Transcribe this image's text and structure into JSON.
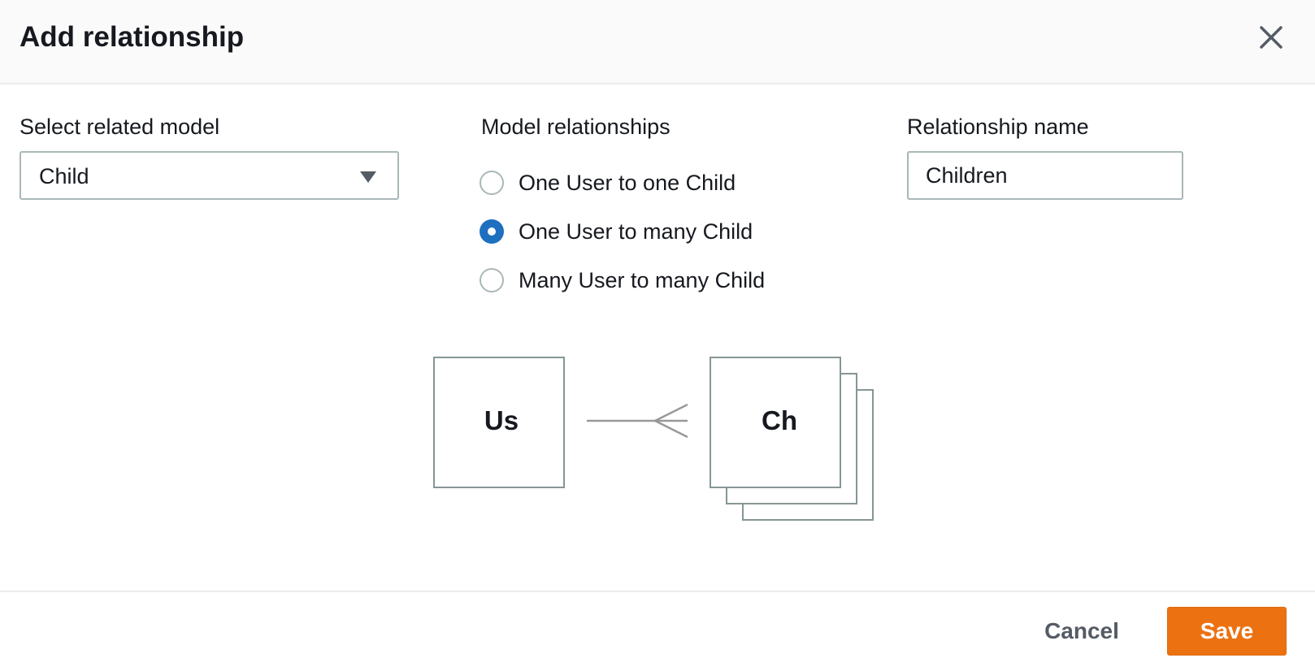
{
  "dialog": {
    "title": "Add relationship",
    "close_icon": "close-icon"
  },
  "related_model": {
    "label": "Select related model",
    "value": "Child",
    "caret_icon": "caret-down-icon"
  },
  "model_relationships": {
    "label": "Model relationships",
    "options": [
      {
        "label": "One User to one Child",
        "checked": false
      },
      {
        "label": "One User to many Child",
        "checked": true
      },
      {
        "label": "Many User to many Child",
        "checked": false
      }
    ]
  },
  "relationship_name": {
    "label": "Relationship name",
    "value": "Children"
  },
  "diagram": {
    "source_abbrev": "Us",
    "target_abbrev": "Ch"
  },
  "footer": {
    "cancel_label": "Cancel",
    "save_label": "Save"
  },
  "colors": {
    "accent": "#ec7211",
    "radio_selected": "#1f6fbf",
    "border": "#aab7b8"
  }
}
